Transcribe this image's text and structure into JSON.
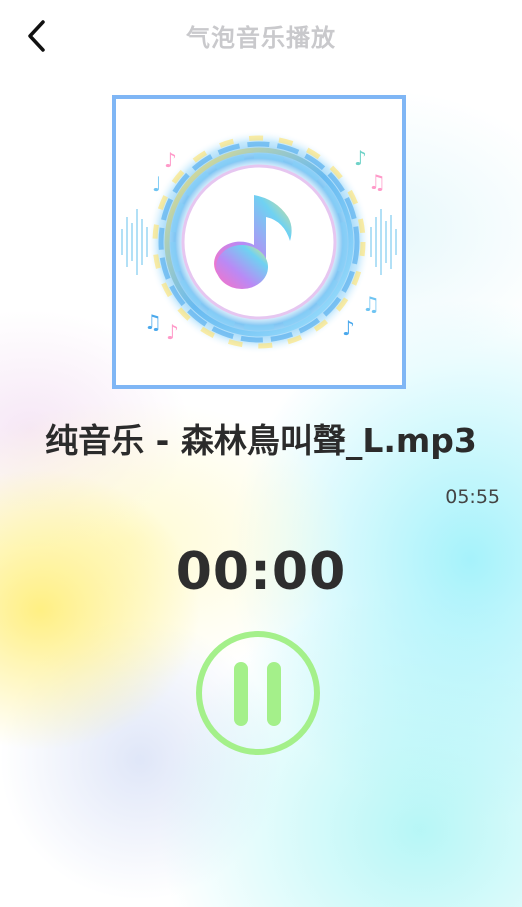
{
  "header": {
    "title": "气泡音乐播放",
    "back_icon": "chevron-left-icon"
  },
  "cover": {
    "icon": "music-note-icon"
  },
  "track": {
    "name": "纯音乐 - 森林鳥叫聲_L.mp3",
    "duration": "05:55",
    "current_time": "00:00"
  },
  "controls": {
    "pause_icon": "pause-icon"
  },
  "colors": {
    "title": "#c9c9cc",
    "cover_border": "#7fb6f5",
    "pause_accent": "#a4f08a",
    "text_dark": "#2b2b2b"
  }
}
